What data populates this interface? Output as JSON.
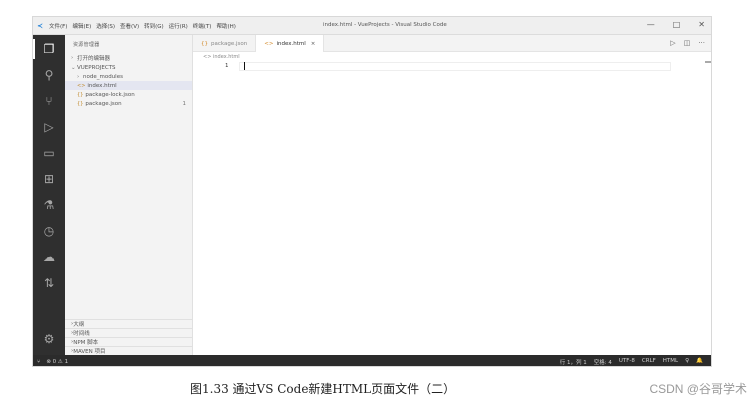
{
  "window": {
    "title": "index.html - VueProjects - Visual Studio Code",
    "menu": [
      "文件(F)",
      "编辑(E)",
      "选择(S)",
      "查看(V)",
      "转到(G)",
      "运行(R)",
      "终端(T)",
      "帮助(H)"
    ],
    "controls": {
      "minimize": "—",
      "maximize": "□",
      "close": "✕"
    }
  },
  "activity_bar": {
    "icons": [
      "files-icon",
      "search-icon",
      "source-control-icon",
      "run-debug-icon",
      "remote-explorer-icon",
      "extensions-icon",
      "testing-icon",
      "timeline-icon",
      "docker-icon",
      "pull-request-icon",
      "account-icon"
    ]
  },
  "sidebar": {
    "header": "资源管理器",
    "open_editors": "打开的编辑器",
    "project": "VUEPROJECTS",
    "items": [
      {
        "label": "node_modules",
        "type": "folder"
      },
      {
        "label": "index.html",
        "type": "file",
        "selected": true
      },
      {
        "label": "package-lock.json",
        "type": "file"
      },
      {
        "label": "package.json",
        "type": "file",
        "badge": "1"
      }
    ],
    "bottom_sections": [
      "大纲",
      "时间线",
      "NPM 脚本",
      "MAVEN 项目"
    ]
  },
  "editor": {
    "tabs": [
      {
        "label": "package.json",
        "active": false
      },
      {
        "label": "index.html",
        "active": true
      }
    ],
    "breadcrumb": "index.html",
    "line_number": "1",
    "actions": {
      "run": "▷",
      "split": "◫",
      "more": "···"
    }
  },
  "status_bar": {
    "left": [
      "⑂",
      "⊗ 0 ⚠ 1"
    ],
    "right": [
      "行 1，列 1",
      "空格: 4",
      "UTF-8",
      "CRLF",
      "HTML",
      "♀",
      "🔔"
    ]
  },
  "caption": "图1.33  通过VS Code新建HTML页面文件（二）",
  "watermark": "CSDN @谷哥学术"
}
